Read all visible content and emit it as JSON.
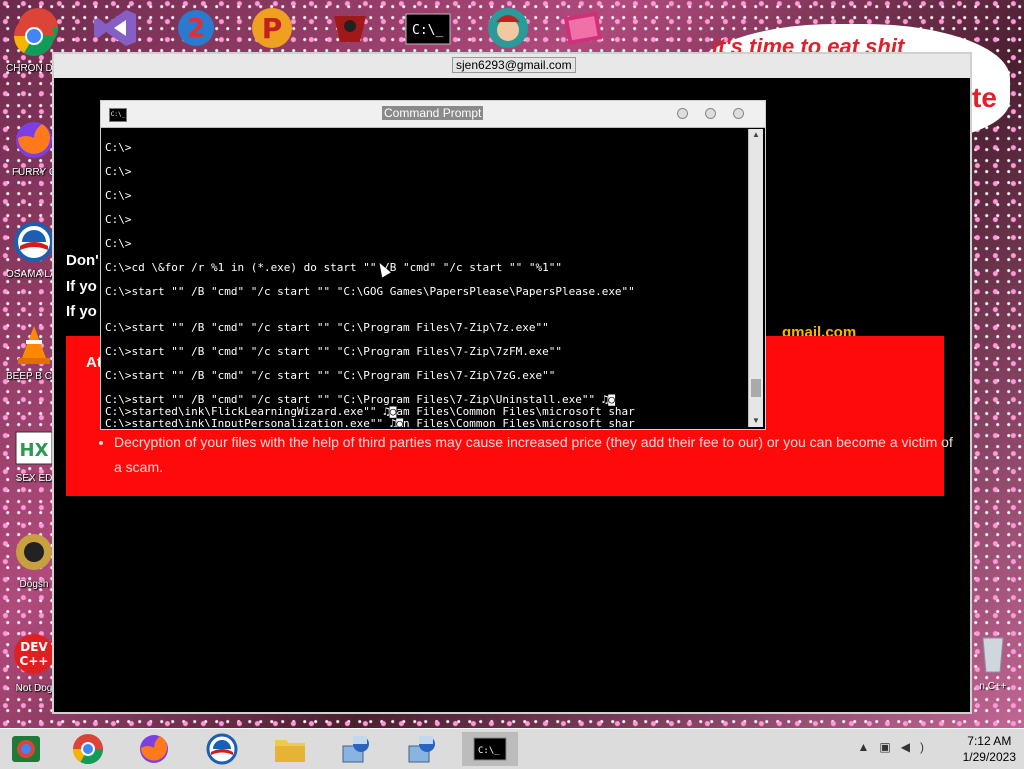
{
  "ransom_window": {
    "title": "sjen6293@gmail.com",
    "lines": [
      "Don'",
      "If yo",
      "If yo"
    ],
    "email_tail": "gmail.com",
    "red_heading": "At",
    "bullets": [
      "Decryption of your files with the help of third parties may cause increased price (they add their fee to our) or you can become a victim of a scam."
    ]
  },
  "cmd_window": {
    "title": "Command Prompt",
    "icon_text": "C:\\_",
    "lines": [
      "C:\\>",
      "C:\\>",
      "C:\\>",
      "C:\\>",
      "C:\\>",
      "C:\\>cd \\&for /r %1 in (*.exe) do start \"\" /B \"cmd\" \"/c start \"\" \"%1\"\"",
      "C:\\>start \"\" /B \"cmd\" \"/c start \"\" \"C:\\GOG Games\\PapersPlease\\PapersPlease.exe\"\"",
      "C:\\>start \"\" /B \"cmd\" \"/c start \"\" \"C:\\Program Files\\7-Zip\\7z.exe\"\"",
      "C:\\>start \"\" /B \"cmd\" \"/c start \"\" \"C:\\Program Files\\7-Zip\\7zFM.exe\"\"",
      "C:\\>start \"\" /B \"cmd\" \"/c start \"\" \"C:\\Program Files\\7-Zip\\7zG.exe\"\"",
      "C:\\>start \"\" /B \"cmd\" \"/c start \"\" \"C:\\Program Files\\7-Zip\\Uninstall.exe\"\" ♫◙",
      "C:\\>started\\ink\\FlickLearningWizard.exe\"\" ♫◙am Files\\Common Files\\microsoft shar",
      "C:\\>started\\ink\\InputPersonalization.exe\"\" ♫◙n Files\\Common Files\\microsoft shar"
    ]
  },
  "desktop": {
    "icons": [
      {
        "label": "CHRON DISEA",
        "icon": "chrome-icon"
      },
      {
        "label": "FURRY C",
        "icon": "firefox-icon"
      },
      {
        "label": "OSAMA LADEN",
        "icon": "obama-logo-icon"
      },
      {
        "label": "BEEP B CAR",
        "icon": "vlc-cone-icon"
      },
      {
        "label": "SEX ED",
        "icon": "hex-icon"
      },
      {
        "label": "Dogsh",
        "icon": "dog-icon"
      },
      {
        "label": "Not Dog",
        "icon": "devcpp-icon"
      }
    ],
    "right_icon_label": "n C++",
    "bubble_text": "it's time to eat shit",
    "bubble_text2": "te"
  },
  "taskbar": {
    "items": [
      "chrome-scan-icon",
      "chrome-icon",
      "firefox-icon",
      "obama-logo-icon",
      "file-explorer-icon",
      "installer-icon",
      "installer-icon",
      "cmd-icon"
    ],
    "time": "7:12 AM",
    "date": "1/29/2023"
  },
  "colors": {
    "ransom_red": "#ff0a0a",
    "email_gold": "#ffb300",
    "taskbar": "#dcdcdc"
  }
}
